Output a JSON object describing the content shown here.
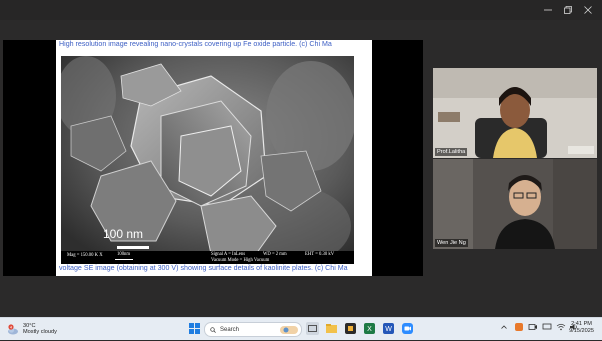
{
  "window": {
    "controls": [
      "minimize-icon",
      "restore-icon",
      "close-icon"
    ]
  },
  "slide": {
    "caption_top": "High resolution image revealing nano-crystals covering up Fe oxide particle. (c) Chi Ma",
    "caption_bottom": "voltage SE image (obtaining at 300 V) showing surface details of kaolinite plates. (c) Chi Ma",
    "sem": {
      "scale_label": "100 nm",
      "mag": "Mag = 150.00 K X",
      "mini_scale": "100nm",
      "signal": "Signal A = InLens",
      "wd": "WD =    2 mm",
      "eht": "EHT =   0.30 kV",
      "vacuum": "Vacuum Mode = High Vacuum"
    }
  },
  "participants": [
    {
      "name": "Prof.Lalitha"
    },
    {
      "name": "Wen Jie Ng"
    }
  ],
  "taskbar": {
    "weather_temp": "30°C",
    "weather_desc": "Mostly cloudy",
    "weather_badge": "4",
    "search_placeholder": "Search",
    "time": "2:41 PM",
    "date": "9/15/2025"
  },
  "colors": {
    "caption": "#3d5fc4",
    "taskbar": "#e6ecf3",
    "titlebar": "#272626"
  }
}
